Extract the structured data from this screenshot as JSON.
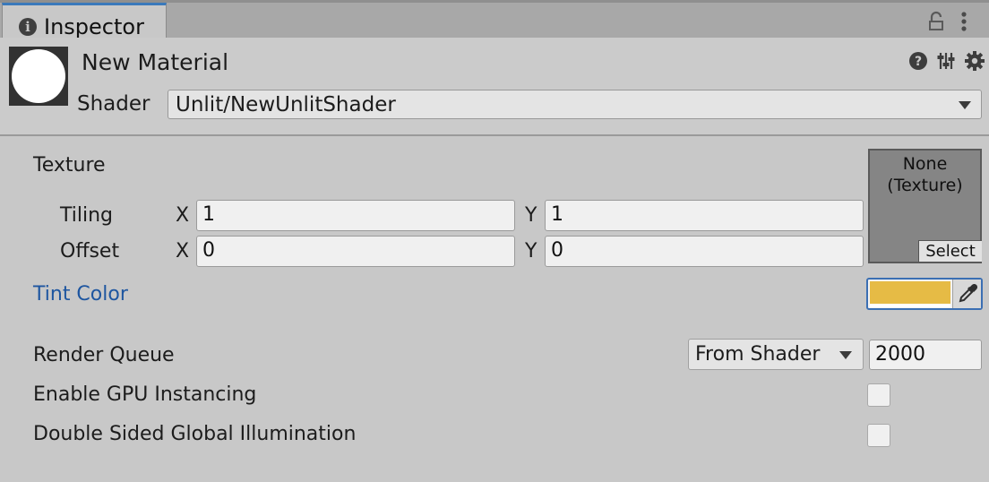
{
  "tab": {
    "title": "Inspector",
    "icon": "info-icon"
  },
  "header": {
    "material_name": "New Material",
    "shader_label": "Shader",
    "shader_value": "Unlit/NewUnlitShader",
    "icons": [
      "help-icon",
      "preset-icon",
      "gear-icon"
    ]
  },
  "texture": {
    "label": "Texture",
    "tiling_label": "Tiling",
    "offset_label": "Offset",
    "x_label": "X",
    "y_label": "Y",
    "tiling_x": "1",
    "tiling_y": "1",
    "offset_x": "0",
    "offset_y": "0",
    "slot_text": "None\n(Texture)",
    "select_label": "Select"
  },
  "tint": {
    "label": "Tint Color",
    "color": "#e6bb45"
  },
  "render_queue": {
    "label": "Render Queue",
    "mode": "From Shader",
    "value": "2000"
  },
  "gpu_instancing": {
    "label": "Enable GPU Instancing",
    "checked": false
  },
  "double_sided_gi": {
    "label": "Double Sided Global Illumination",
    "checked": false
  },
  "colors": {
    "accent": "#3a79bb",
    "link_label": "#1e56a0"
  }
}
